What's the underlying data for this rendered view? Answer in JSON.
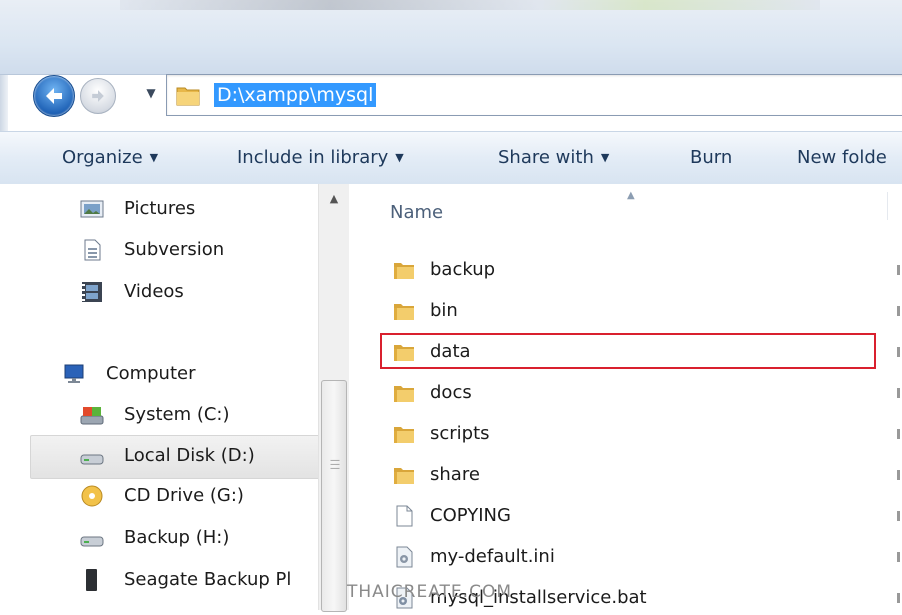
{
  "address": {
    "path": "D:\\xampp\\mysql"
  },
  "toolbar": {
    "organize": "Organize",
    "include_in_library": "Include in library",
    "share_with": "Share with",
    "burn": "Burn",
    "new_folder": "New folde"
  },
  "nav": {
    "items": [
      {
        "label": "Pictures",
        "icon": "pictures-icon"
      },
      {
        "label": "Subversion",
        "icon": "document-icon"
      },
      {
        "label": "Videos",
        "icon": "videos-icon"
      },
      {
        "label": "Computer",
        "icon": "computer-icon"
      },
      {
        "label": "System  (C:)",
        "icon": "system-drive-icon"
      },
      {
        "label": "Local Disk (D:)",
        "icon": "drive-icon"
      },
      {
        "label": "CD Drive (G:)",
        "icon": "cd-drive-icon"
      },
      {
        "label": "Backup (H:)",
        "icon": "drive-icon"
      },
      {
        "label": "Seagate Backup Pl",
        "icon": "external-drive-icon"
      }
    ],
    "selected": "Local Disk (D:)"
  },
  "files": {
    "column_name": "Name",
    "rows": [
      {
        "name": "backup",
        "type": "folder"
      },
      {
        "name": "bin",
        "type": "folder"
      },
      {
        "name": "data",
        "type": "folder"
      },
      {
        "name": "docs",
        "type": "folder"
      },
      {
        "name": "scripts",
        "type": "folder"
      },
      {
        "name": "share",
        "type": "folder"
      },
      {
        "name": "COPYING",
        "type": "file"
      },
      {
        "name": "my-default.ini",
        "type": "ini"
      },
      {
        "name": "mysql_installservice.bat",
        "type": "bat"
      }
    ],
    "highlighted": "data"
  },
  "watermark": "THAICREATE.COM",
  "colors": {
    "selection": "#3399ff",
    "highlight_border": "#d9202e",
    "toolbar_text": "#1e395b",
    "folder": "#e8b84a"
  }
}
